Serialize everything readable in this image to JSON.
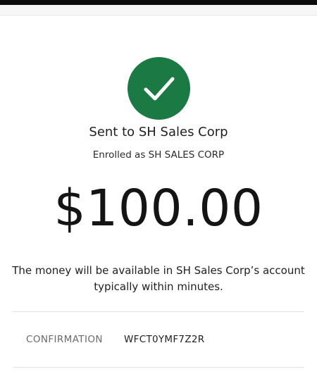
{
  "status": {
    "icon": "checkmark-icon",
    "color": "#1b7a43"
  },
  "recipient": {
    "sent_to": "Sent to SH Sales Corp",
    "enrolled_as": "Enrolled as SH SALES CORP"
  },
  "payment": {
    "amount": "$100.00",
    "availability": "The money will be available in SH Sales Corp’s account typically within minutes."
  },
  "confirmation": {
    "label": "CONFIRMATION",
    "value": "WFCT0YMF7Z2R"
  }
}
